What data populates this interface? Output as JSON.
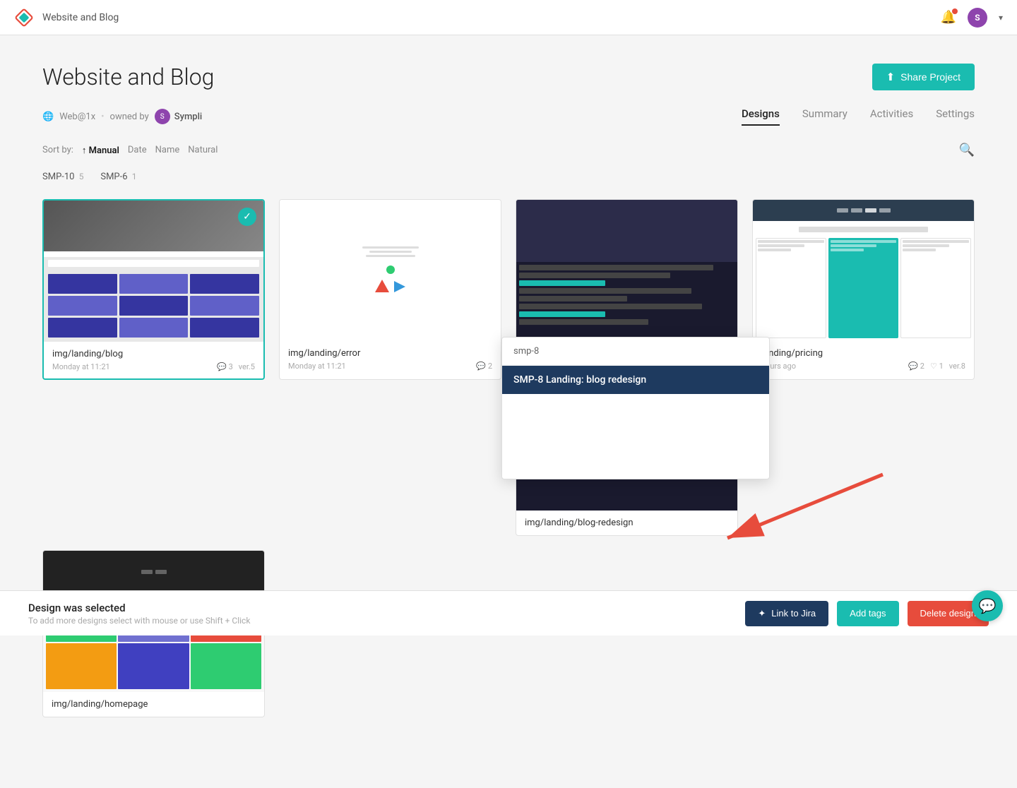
{
  "app": {
    "name": "Sympli",
    "logo_symbol": "◈"
  },
  "topnav": {
    "title": "Website and Blog",
    "user_initials": "S"
  },
  "page": {
    "title": "Website and Blog",
    "share_button_label": "Share Project"
  },
  "meta": {
    "globe_text": "Web@1x",
    "owned_by": "owned by",
    "owner_name": "Sympli"
  },
  "tabs": [
    {
      "id": "designs",
      "label": "Designs",
      "active": true
    },
    {
      "id": "summary",
      "label": "Summary",
      "active": false
    },
    {
      "id": "activities",
      "label": "Activities",
      "active": false
    },
    {
      "id": "settings",
      "label": "Settings",
      "active": false
    }
  ],
  "sortby": {
    "label": "Sort by:",
    "options": [
      {
        "id": "manual",
        "label": "Manual",
        "active": true,
        "arrow": "↑"
      },
      {
        "id": "date",
        "label": "Date",
        "active": false
      },
      {
        "id": "name",
        "label": "Name",
        "active": false
      },
      {
        "id": "natural",
        "label": "Natural",
        "active": false
      }
    ]
  },
  "filters": [
    {
      "id": "smp-10",
      "label": "SMP-10",
      "count": "5"
    },
    {
      "id": "smp-6",
      "label": "SMP-6",
      "count": "1"
    }
  ],
  "designs": [
    {
      "id": "card1",
      "name": "img/landing/blog",
      "date": "Monday at 11:21",
      "comments": "3",
      "version": "ver.5",
      "selected": true,
      "thumb_type": "blog"
    },
    {
      "id": "card2",
      "name": "img/landing/error",
      "date": "Monday at 11:21",
      "comments": "2",
      "version": "",
      "selected": false,
      "thumb_type": "error"
    },
    {
      "id": "card3",
      "name": "img/landing/blog-redesign",
      "date": "",
      "comments": "",
      "version": "",
      "selected": false,
      "thumb_type": "blog_redesign",
      "tall": true
    },
    {
      "id": "card4",
      "name": "landing/pricing",
      "date": "hours ago",
      "comments": "2",
      "version": "ver.8",
      "comment2": "1",
      "selected": false,
      "thumb_type": "pricing"
    }
  ],
  "second_row": [
    {
      "id": "card5",
      "name": "img/landing/homepage",
      "date": "",
      "thumb_type": "second_card"
    }
  ],
  "tooltip": {
    "header": "smp-8",
    "item": "SMP-8 Landing: blog redesign"
  },
  "bottom_bar": {
    "title": "Design was selected",
    "subtitle": "To add more designs select with mouse or use Shift + Click",
    "link_jira_label": "Link to Jira",
    "add_tags_label": "Add tags",
    "delete_label": "Delete design"
  },
  "colors": {
    "teal": "#1abcb0",
    "dark_blue": "#1e3a5f",
    "red": "#e74c3c"
  }
}
